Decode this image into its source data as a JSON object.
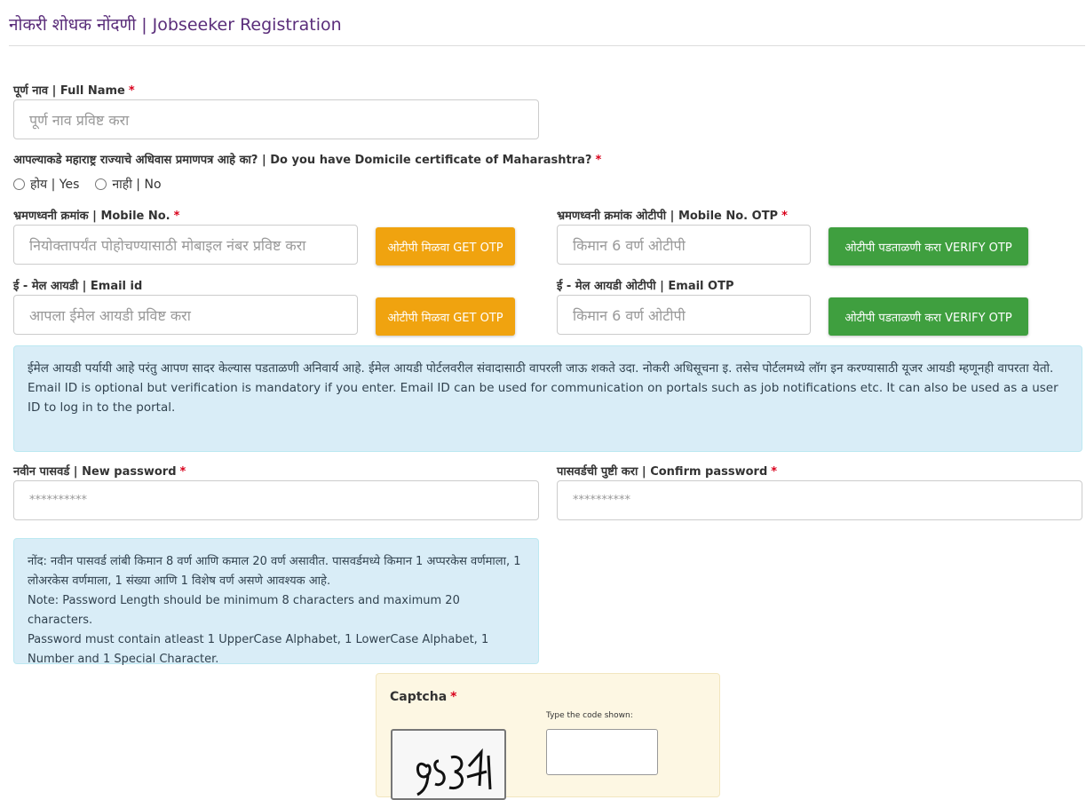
{
  "header": {
    "title": "नोकरी शोधक नोंदणी | Jobseeker Registration"
  },
  "form": {
    "required_mark": "*",
    "full_name": {
      "label": "पूर्ण नाव | Full Name",
      "placeholder": "पूर्ण नाव प्रविष्ट करा"
    },
    "domicile": {
      "question": "आपल्याकडे महाराष्ट्र राज्याचे अधिवास प्रमाणपत्र आहे का? | Do you have Domicile certificate of Maharashtra?",
      "options": [
        "होय | Yes",
        "नाही | No"
      ]
    },
    "mobile": {
      "label": "भ्रमणध्वनी क्रमांक | Mobile No.",
      "placeholder": "नियोक्तापर्यंत पोहोचण्यासाठी मोबाइल नंबर प्रविष्ट करा",
      "button": "ओटीपी मिळवा GET OTP"
    },
    "mobile_otp": {
      "label": "भ्रमणध्वनी क्रमांक ओटीपी | Mobile No. OTP",
      "placeholder": "किमान 6 वर्ण ओटीपी",
      "button": "ओटीपी पडताळणी करा VERIFY OTP"
    },
    "email": {
      "label": "ई - मेल आयडी | Email id",
      "placeholder": "आपला ईमेल आयडी प्रविष्ट करा",
      "button": "ओटीपी मिळवा GET OTP"
    },
    "email_otp": {
      "label": "ई - मेल आयडी ओटीपी | Email OTP",
      "placeholder": "किमान 6 वर्ण ओटीपी",
      "button": "ओटीपी पडताळणी करा VERIFY OTP"
    },
    "email_info": {
      "marathi": "ईमेल आयडी पर्यायी आहे परंतु आपण सादर केल्यास पडताळणी अनिवार्य आहे. ईमेल आयडी पोर्टलवरील संवादासाठी वापरली जाऊ शकते उदा. नोकरी अधिसूचना इ. तसेच पोर्टलमध्ये लॉग इन करण्यासाठी यूजर आयडी म्हणूनही वापरता येतो.",
      "english": "Email ID is optional but verification is mandatory if you enter. Email ID can be used for communication on portals such as job notifications etc. It can also be used as a user ID to log in to the portal."
    },
    "new_password": {
      "label": "नवीन पासवर्ड | New password",
      "placeholder": "**********"
    },
    "confirm_password": {
      "label": "पासवर्डची पुष्टी करा | Confirm password",
      "placeholder": "**********"
    },
    "password_note": {
      "marathi": "नोंद: नवीन पासवर्ड लांबी किमान 8 वर्ण आणि कमाल 20 वर्ण असावीत. पासवर्डमध्ये किमान 1 अप्परकेस वर्णमाला, 1 लोअरकेस वर्णमाला, 1 संख्या आणि 1 विशेष वर्ण असणे आवश्यक आहे.",
      "english1": "Note: Password Length should be minimum 8 characters and maximum 20 characters.",
      "english2": "Password must contain atleast 1 UpperCase Alphabet, 1 LowerCase Alphabet, 1 Number and 1 Special Character."
    },
    "captcha": {
      "label": "Captcha",
      "hint": "Type the code shown:"
    }
  }
}
